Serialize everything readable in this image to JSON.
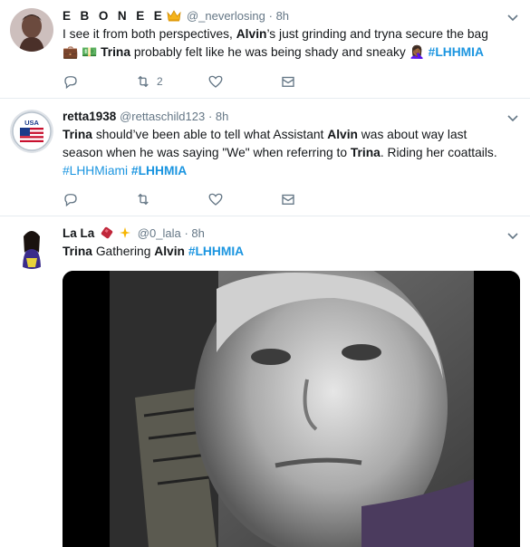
{
  "tweets": [
    {
      "display_name": "E B O N E E",
      "handle": "@_neverlosing",
      "time": "· 8h",
      "text": [
        {
          "t": "I see it from both perspectives, ",
          "s": "n"
        },
        {
          "t": "Alvin",
          "s": "b"
        },
        {
          "t": "’s just grinding and tryna secure the bag ",
          "s": "n"
        },
        {
          "t": "💼",
          "s": "e"
        },
        {
          "t": " ",
          "s": "n"
        },
        {
          "t": "💵",
          "s": "e"
        },
        {
          "t": " ",
          "s": "n"
        },
        {
          "t": "Trina",
          "s": "b"
        },
        {
          "t": " probably felt like he was being shady and sneaky ",
          "s": "n"
        },
        {
          "t": "🤦🏾‍♀️",
          "s": "e"
        },
        {
          "t": " ",
          "s": "n"
        },
        {
          "t": "#LHHMIA",
          "s": "tag"
        }
      ],
      "actions": {
        "reply": "",
        "retweet": "2",
        "like": "",
        "dm": ""
      }
    },
    {
      "display_name": "retta1938",
      "handle": "@rettaschild123",
      "time": "· 8h",
      "avatar_text": "USA",
      "text": [
        {
          "t": "Trina",
          "s": "b"
        },
        {
          "t": " should’ve been able to tell what Assistant ",
          "s": "n"
        },
        {
          "t": "Alvin",
          "s": "b"
        },
        {
          "t": " was about way last season when he was saying \"We\" when referring to ",
          "s": "n"
        },
        {
          "t": "Trina",
          "s": "b"
        },
        {
          "t": ".  Riding her coattails. ",
          "s": "n"
        },
        {
          "t": "#LHHMiami",
          "s": "tagn"
        },
        {
          "t": " ",
          "s": "n"
        },
        {
          "t": "#LHHMIA",
          "s": "tag"
        }
      ],
      "actions": {
        "reply": "",
        "retweet": "",
        "like": "",
        "dm": ""
      }
    },
    {
      "display_name": "La La",
      "handle": "@0_lala",
      "time": "· 8h",
      "text": [
        {
          "t": "Trina",
          "s": "b"
        },
        {
          "t": " Gathering ",
          "s": "n"
        },
        {
          "t": "Alvin",
          "s": "b"
        },
        {
          "t": " ",
          "s": "n"
        },
        {
          "t": "#LHHMIA",
          "s": "tag"
        }
      ]
    }
  ],
  "icons": [
    "reply-icon",
    "retweet-icon",
    "like-icon",
    "dm-icon",
    "caret-down-icon",
    "crown-icon"
  ],
  "colors": {
    "link": "#1b95e0",
    "muted": "#657786",
    "text": "#14171a",
    "divider": "#e6ecf0"
  }
}
